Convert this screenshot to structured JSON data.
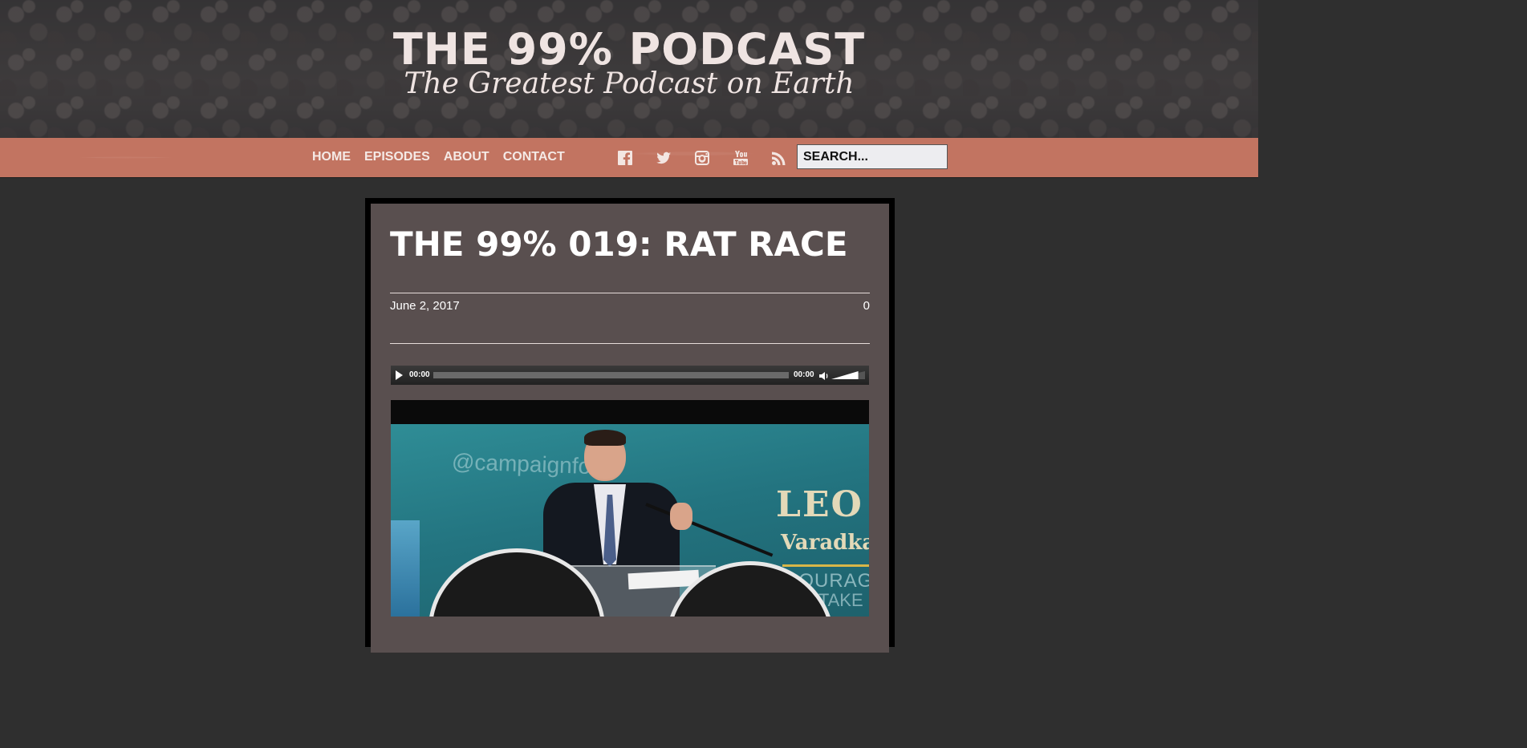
{
  "header": {
    "site_title": "THE 99% PODCAST",
    "tagline": "The Greatest Podcast on Earth"
  },
  "nav": {
    "items": [
      {
        "label": "HOME"
      },
      {
        "label": "EPISODES"
      },
      {
        "label": "ABOUT"
      },
      {
        "label": "CONTACT"
      }
    ],
    "social_icons": [
      "facebook-icon",
      "twitter-icon",
      "instagram-icon",
      "youtube-icon",
      "rss-icon"
    ],
    "search": {
      "placeholder": "SEARCH...",
      "value": ""
    }
  },
  "post": {
    "title": "THE 99% 019: RAT RACE",
    "date": "June 2, 2017",
    "comment_count": "0",
    "player": {
      "current_time": "00:00",
      "duration": "00:00",
      "progress": 0,
      "volume": 0.8
    },
    "image": {
      "banner_handle": "@campaignfo",
      "banner_name": "LEO",
      "banner_sub": "Varadkar",
      "banner_courage": "COURAGE",
      "banner_take": "O TAKE U"
    }
  },
  "colors": {
    "page_background": "#2f2f2f",
    "nav_background": "#c27461",
    "card_background": "#594f4f",
    "card_border": "#000000",
    "text_light": "#ffffff"
  }
}
